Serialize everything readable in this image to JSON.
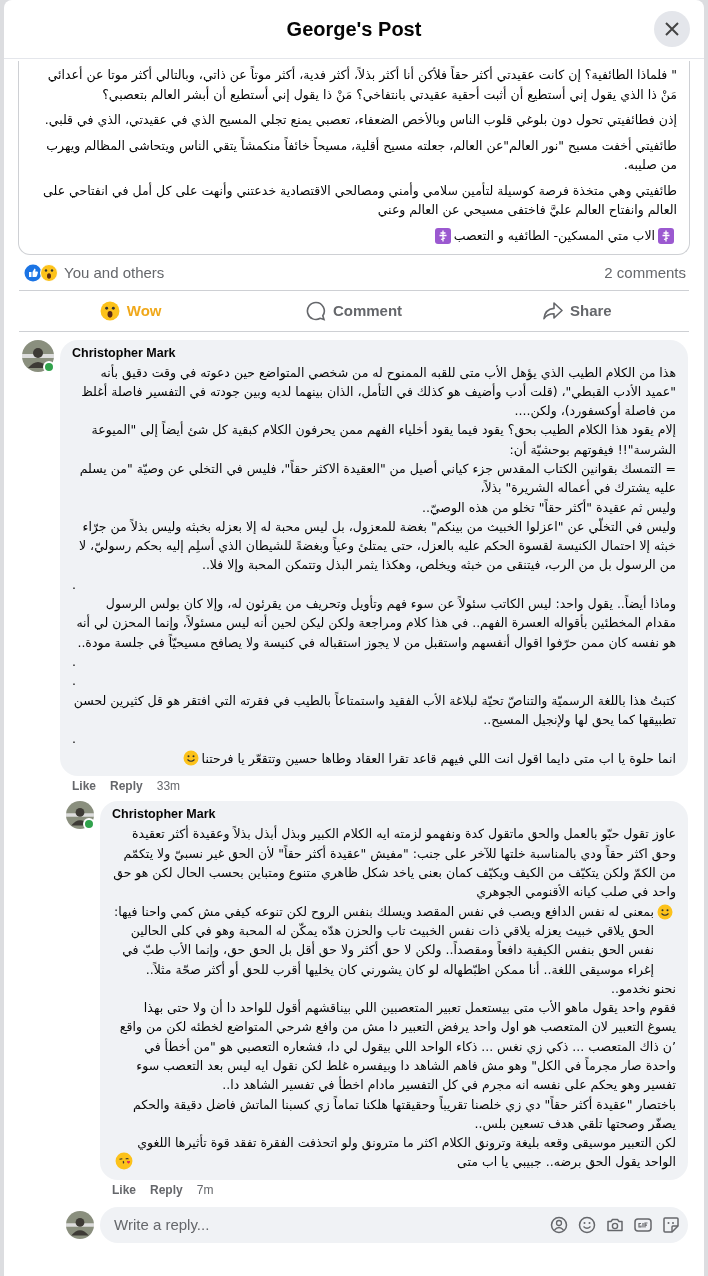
{
  "header": {
    "title": "George's Post"
  },
  "post": {
    "paragraphs": [
      [
        {
          "kind": "text",
          "text": "\" فلماذا الطائفية؟ إن كانت عقيدتي أكثر حقاً فلأكن أنا أكثر بذلاً، أكثر فدية، أكثر موتاً عن ذاتي، وبالتالي أكثر موتا عن أعدائي مَنْ ذا الذي يقول إني أستطيع أن أثبت أحقية عقيدتي بانتفاخي؟ مَنْ ذا يقول إني أستطيع أن أبشر العالم بتعصبي؟"
        }
      ],
      [
        {
          "kind": "text",
          "text": "إذن فطائفيتي تحول دون بلوغي قلوب الناس وبالأخص الضعفاء، تعصبي يمنع تجلي المسيح الذي في عقيدتي، الذي في قلبي."
        }
      ],
      [
        {
          "kind": "text",
          "text": "طائفيتي أخفت مسيح \"نور العالم\"عن العالم، جعلته مسيح أقلية، مسيحاً خائفاً منكمشاً يتقي الناس ويتحاشى المظالم ويهرب من صليبه."
        }
      ],
      [
        {
          "kind": "text",
          "text": "طائفيتي وهي متخذة فرصة كوسيلة لتأمين سلامي وأمني ومصالحي الاقتصادية خدعتني وأنهت على كل أمل في انفتاحي على العالم وانفتاح العالم عليَّ فاختفى مسيحي عن العالم وعني"
        }
      ],
      [
        {
          "kind": "cross"
        },
        {
          "kind": "text",
          "text": "الاب متي المسكين- الطائفيه و التعصب"
        },
        {
          "kind": "cross"
        }
      ]
    ]
  },
  "reactions": {
    "summary": "You and others",
    "comments": "2 comments"
  },
  "actions": {
    "wow": {
      "label": "Wow",
      "selected": true
    },
    "comment": {
      "label": "Comment",
      "selected": false
    },
    "share": {
      "label": "Share",
      "selected": false
    }
  },
  "comments": [
    {
      "author": "Christopher Mark",
      "online": true,
      "time": "33m",
      "like": "Like",
      "reply": "Reply",
      "paragraphs": [
        [
          {
            "kind": "text",
            "text": "هذا من الكلام الطيب الذي يؤهل الأب متى للقبه الممنوح له من شخصي المتواضع حين دعوته في وقت دقيق بأنه \"عميد الأدب القبطي\"، (قلت أدب وأضيف هو كذلك في التأمل، الذان بينهما لديه وبين جودته في التفسير فاصلة أغلظ من فاصلة أوكسفورد)، ولكن...."
          }
        ],
        [
          {
            "kind": "text",
            "text": "إلام يقود هذا الكلام الطيب بحق؟ يقود فيما يقود أخلياء الفهم ممن يحرفون الكلام كبقية كل شئ أيضاً إلى \"الميوعة الشرسة\"!! فيفوتهم بوحشيّة أن:"
          }
        ],
        [
          {
            "kind": "text",
            "text": "= التمسك بقوانين الكتاب المقدس جزء كياني أصيل من \"العقيدة الاكثر حقاً\"، فليس في التخلي عن وصيّة \"من يسلم عليه يشترك في أعماله الشريرة\" بذلاً،"
          }
        ],
        [
          {
            "kind": "text",
            "text": "وليس ثم عقيدة \"أكثر حقاً\" تخلو من هذه الوصيّ.."
          }
        ],
        [
          {
            "kind": "text",
            "text": "وليس في التخلّي عن \"اعزلوا الخبيث من بينكم\" بغضة للمعزول، بل ليس محبة له إلا بعزله بخبثه وليس بذلاً من جرّاء خبثه إلا احتمال الكنيسة لقسوة الحكم عليه بالعزل، حتى يمتلئ وعياً وبغضةً للشيطان الذي أسلِم إليه بحكم رسوليّ، لا من الرسول بل من الرب، فيتنقى من خبثه ويخلص، وهكذا يثمر البذل وتتمكن المحبة وإلا فلا.."
          }
        ],
        [
          {
            "kind": "text",
            "text": "."
          }
        ],
        [
          {
            "kind": "text",
            "text": "وماذا أيضاً.. يقول واحد: ليس الكاتب سئولاً عن سوء فهم وتأويل وتحريف من يقرئون له، وإلا كان بولس الرسول مقدام المخطئين بأقواله العسرة الفهم.. في هذا كلام ومراجعة ولكن ليكن لحين أنه ليس مسئولاً، وإنما المحزن لي أنه هو نفسه كان ممن حرّفوا اقوال أنفسهم واستقبل من لا يجوز استقباله في كنيسة ولا يصافح مسيحيّاً في جلسة مودة.."
          }
        ],
        [
          {
            "kind": "text",
            "text": "."
          }
        ],
        [
          {
            "kind": "text",
            "text": "."
          }
        ],
        [
          {
            "kind": "text",
            "text": "كتبتُ هذا باللغة الرسميّة والتناصّ تحيّة لبلاغة الأب الفقيد واستمتاعاً بالطيب في فقرته التي افتقر هو قل كثيرين لحسن تطبيقها كما يحق لها ولإنجيل المسيح.."
          }
        ],
        [
          {
            "kind": "text",
            "text": "."
          }
        ],
        [
          {
            "kind": "text",
            "text": "انما حلوة يا اب متى دايما اقول انت اللي فيهم قاعد تقرا العقاد وطاها حسين وتتقعّر يا فرحتنا"
          },
          {
            "kind": "smile"
          }
        ]
      ],
      "replies": [
        {
          "author": "Christopher Mark",
          "online": true,
          "time": "7m",
          "like": "Like",
          "reply": "Reply",
          "paragraphs": [
            [
              {
                "kind": "text",
                "text": "عاوز تقول حبّو بالعمل والحق ماتقول كدة ونفهمو لزمته ايه الكلام الكبير وبذل أبذل بذلاً وعقيدة أكثر تعقيدة وحق اكثر حقاً ودي بالمناسبة خلتها للآخر على جنب: \"مفيش \"عقيدة أكثر حقاً\" لأن الحق غير نسبيّ ولا يتكمّم من الكمّ ولكن يتكيّف من الكيف ويكيّف كمان بعنى ياخد شكل ظاهري متنوع ومتباين بحسب الحال لكن هو حق واحد في صلب كيانه الأقنومي الجوهري"
              },
              {
                "kind": "smile"
              },
              {
                "kind": "text",
                "text": "بمعنى له نفس الدافع ويصب في نفس المقصد ويسلك بنفس الروح لكن تنوعه كيفي مش كمي واحنا فيها: الحق يلاقي خبيث يعزله يلاقي ذات نفس الخبيث تاب والحزن هدّه يمكّن له المحبة وهو في كلى الحالين نفس الحق بنفس الكيفية دافعاً ومقصداً.. ولكن لا حق أكثر ولا حق أقل بل الحق حق، وإنما الأب طبّ في إغراء موسيقى اللغة.. أنا ممكن اظبّطهاله لو كان يشورني كان يخليها أقرب للحق أو أكثر صحّة مثلاً.."
              }
            ],
            [
              {
                "kind": "text",
                "text": "نحنو نخدمو.."
              }
            ],
            [
              {
                "kind": "text",
                "text": "فقوم واحد يقول ماهو الأب متى بيستعمل تعبير المتعصبين اللي بيناقشهم أقول للواحد دا أن ولا حتى بهذا يسوغ التعبير لان المتعصب هو اول واحد يرفض التعبير دا مش من وافع شرحي المتواضع لخطئه لكن من واقع ’ن ذاك المتعصب ... ذكي زي نغس ... ذكاء الواحد اللي بيقول لي دا، فشعاره التعصبي هو \"من أخطأ في واحدة صار مجرماً في الكل\" وهو مش فاهم الشاهد دا وبيفسره غلط لكن نقول ايه ليس بعد التعصب سوء تفسير وهو يحكم على نفسه انه مجرم في كل التفسير مادام اخطأ في تفسير الشاهد دا.."
              }
            ],
            [
              {
                "kind": "text",
                "text": "باختصار \"عقيدة أكثر حقاً\" دي زي خلصنا تقريباً وحقيقتها هلكنا تماماً زي كسبنا الماتش فاضل دقيقة والحكم يصفّر وصحتها تلقي هدف تسعين بلس.."
              }
            ],
            [
              {
                "kind": "text",
                "text": "لكن التعبير موسيقى وقعه بليغة وترونق الكلام اكثر ما مترونق ولو اتحذفت الفقرة تفقد قوة تأثيرها اللغوي الواحد يقول الحق برضه.. جبيبي يا اب متى"
              },
              {
                "kind": "kiss"
              }
            ]
          ]
        }
      ]
    }
  ],
  "reply_box": {
    "placeholder": "Write a reply..."
  }
}
